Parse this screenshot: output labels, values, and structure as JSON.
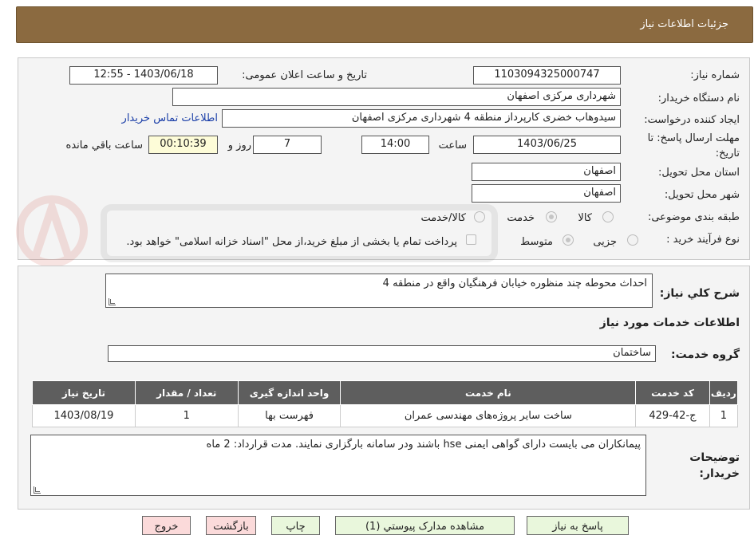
{
  "header": {
    "title": "جزئیات اطلاعات نیاز"
  },
  "fields": {
    "need_number_label": "شماره نیاز:",
    "need_number": "1103094325000747",
    "announce_label": "تاریخ و ساعت اعلان عمومی:",
    "announce_value": "1403/06/18 - 12:55",
    "buyer_org_label": "نام دستگاه خریدار:",
    "buyer_org": "شهرداری مرکزی اصفهان",
    "requester_label": "ایجاد کننده درخواست:",
    "requester": "سیدوهاب خضری کارپرداز منطقه 4 شهرداری مرکزی اصفهان",
    "contact_link": "اطلاعات تماس خریدار",
    "deadline_label_1": "مهلت ارسال پاسخ: تا",
    "deadline_label_2": "تاریخ:",
    "deadline_date": "1403/06/25",
    "time_label": "ساعت",
    "deadline_time": "14:00",
    "days_value": "7",
    "days_label": "روز و",
    "remaining_value": "00:10:39",
    "remaining_label": "ساعت باقي مانده",
    "province_label": "استان محل تحویل:",
    "province": "اصفهان",
    "city_label": "شهر محل تحویل:",
    "city": "اصفهان",
    "category_label": "طبقه بندی موضوعی:",
    "category_options": [
      "کالا",
      "خدمت",
      "کالا/خدمت"
    ],
    "process_label": "نوع فرآیند خرید :",
    "process_options": [
      "جزیی",
      "متوسط"
    ],
    "payment_note": "پرداخت تمام یا بخشی از مبلغ خرید،از محل \"اسناد خزانه اسلامی\" خواهد بود."
  },
  "description": {
    "label": "شرح کلي نياز:",
    "value": "احداث محوطه چند منظوره خیابان فرهنگیان واقع در منطقه 4"
  },
  "services": {
    "section_title": "اطلاعات خدمات مورد نیاز",
    "group_label": "گروه خدمت:",
    "group_value": "ساختمان",
    "columns": [
      "ردیف",
      "کد خدمت",
      "نام خدمت",
      "واحد اندازه گیری",
      "تعداد / مقدار",
      "تاریخ نیاز"
    ],
    "rows": [
      [
        "1",
        "ج-42-429",
        "ساخت سایر پروژه‌های مهندسی عمران",
        "فهرست بها",
        "1",
        "1403/08/19"
      ]
    ]
  },
  "buyer_notes": {
    "label_1": "توضیحات",
    "label_2": "خریدار:",
    "value": "پیمانکاران می بایست دارای گواهی ایمنی hse باشند ودر سامانه بارگزاری نمایند. مدت قرارداد: 2 ماه"
  },
  "buttons": {
    "reply": "پاسخ به نياز",
    "attachments": "مشاهده مدارک پیوستي (1)",
    "print": "چاپ",
    "back": "بازگشت",
    "exit": "خروج"
  },
  "colors": {
    "header_bg": "#8b6a40",
    "table_header": "#5e5e5e",
    "btn_green": "#e9f7dc",
    "btn_red": "#fbdada"
  }
}
